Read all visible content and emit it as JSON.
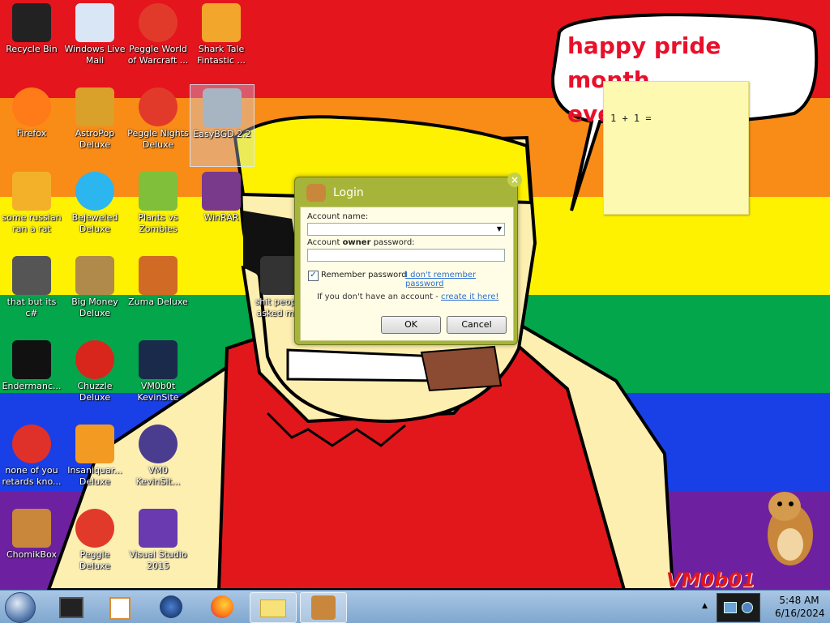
{
  "wallpaper": {
    "stripes": [
      "#e4151d",
      "#f98b17",
      "#fef201",
      "#03a64b",
      "#1840e6",
      "#6d21a0"
    ],
    "speech_text_line1": "happy pride month",
    "speech_text_line2": "everyone!",
    "signature": "VM0b01"
  },
  "desktop_icons": [
    {
      "label": "Recycle Bin",
      "icon": "recycle-bin-icon"
    },
    {
      "label": "Windows Live Mail",
      "icon": "mail-icon"
    },
    {
      "label": "Peggle World of Warcraft ...",
      "icon": "peggle-icon"
    },
    {
      "label": "Shark Tale Fintastic ...",
      "icon": "fish-icon"
    },
    {
      "label": "Firefox",
      "icon": "firefox-icon"
    },
    {
      "label": "AstroPop Deluxe",
      "icon": "astropop-icon"
    },
    {
      "label": "Peggle Nights Deluxe",
      "icon": "peggle-icon"
    },
    {
      "label": "EasyBGD 2.2",
      "icon": "easybgd-icon"
    },
    {
      "label": "some russian ran a rat",
      "icon": "de-icon"
    },
    {
      "label": "Bejeweled Deluxe",
      "icon": "gem-icon"
    },
    {
      "label": "Plants vs Zombies",
      "icon": "plant-icon"
    },
    {
      "label": "WinRAR",
      "icon": "winrar-icon"
    },
    {
      "label": "that but its c#",
      "icon": "stack-icon"
    },
    {
      "label": "Big Money Deluxe",
      "icon": "money-bag-icon"
    },
    {
      "label": "Zuma Deluxe",
      "icon": "zuma-icon"
    },
    {
      "label": "shit people asked m...",
      "icon": "document-icon"
    },
    {
      "label": "Endermanc...",
      "icon": "terminal-icon"
    },
    {
      "label": "Chuzzle Deluxe",
      "icon": "chuzzle-icon"
    },
    {
      "label": "VM0b0t KevinSite",
      "icon": "vm-icon"
    },
    {
      "label": "none of you retards kno...",
      "icon": "red-dino-icon"
    },
    {
      "label": "Insaniquar... Deluxe",
      "icon": "goldfish-icon"
    },
    {
      "label": "VM0 KevinSit...",
      "icon": "firefox-file-icon"
    },
    {
      "label": "ChomikBox",
      "icon": "chomikbox-icon"
    },
    {
      "label": "Peggle Deluxe",
      "icon": "peggle-icon"
    },
    {
      "label": "Visual Studio 2015",
      "icon": "visual-studio-icon"
    }
  ],
  "sticky_note": {
    "text": "1 + 1 ="
  },
  "login": {
    "title": "Login",
    "close": "×",
    "account_label": "Account name:",
    "account_value": "",
    "password_label_pre": "Account ",
    "password_label_bold": "owner",
    "password_label_post": " password:",
    "password_value": "",
    "remember": "Remember password",
    "remember_checked": true,
    "forgot": "I don't remember password",
    "signup_prefix": "If you don't have an account - ",
    "signup_link": "create it here!",
    "ok": "OK",
    "cancel": "Cancel"
  },
  "taskbar": {
    "start": "windows-start-icon",
    "items": [
      "terminal-app",
      "media-app",
      "game-app",
      "firefox-app",
      "explorer-app",
      "chomikbox-app"
    ],
    "time": "5:48 AM",
    "date": "6/16/2024"
  }
}
